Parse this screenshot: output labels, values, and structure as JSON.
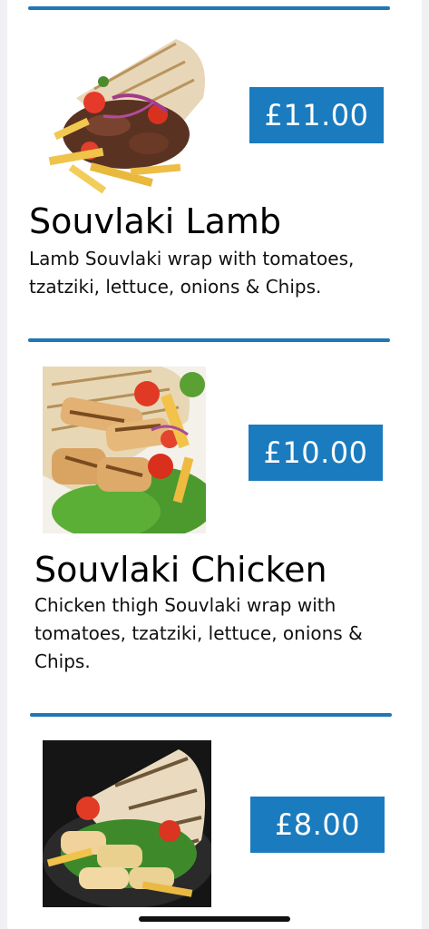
{
  "theme": {
    "accent": "#1a7bbf",
    "rule_color": "#1f77b4"
  },
  "menu": {
    "items": [
      {
        "title": "Souvlaki Lamb",
        "description": "Lamb Souvlaki wrap with tomatoes, tzatziki, lettuce, onions & Chips.",
        "price": "£11.00",
        "image_icon": "lamb-souvlaki-wrap-image"
      },
      {
        "title": "Souvlaki Chicken",
        "description": "Chicken thigh Souvlaki wrap with tomatoes, tzatziki, lettuce, onions & Chips.",
        "price": "£10.00",
        "image_icon": "chicken-souvlaki-wrap-image"
      },
      {
        "title": "",
        "description": "",
        "price": "£8.00",
        "image_icon": "halloumi-souvlaki-wrap-image"
      }
    ]
  }
}
